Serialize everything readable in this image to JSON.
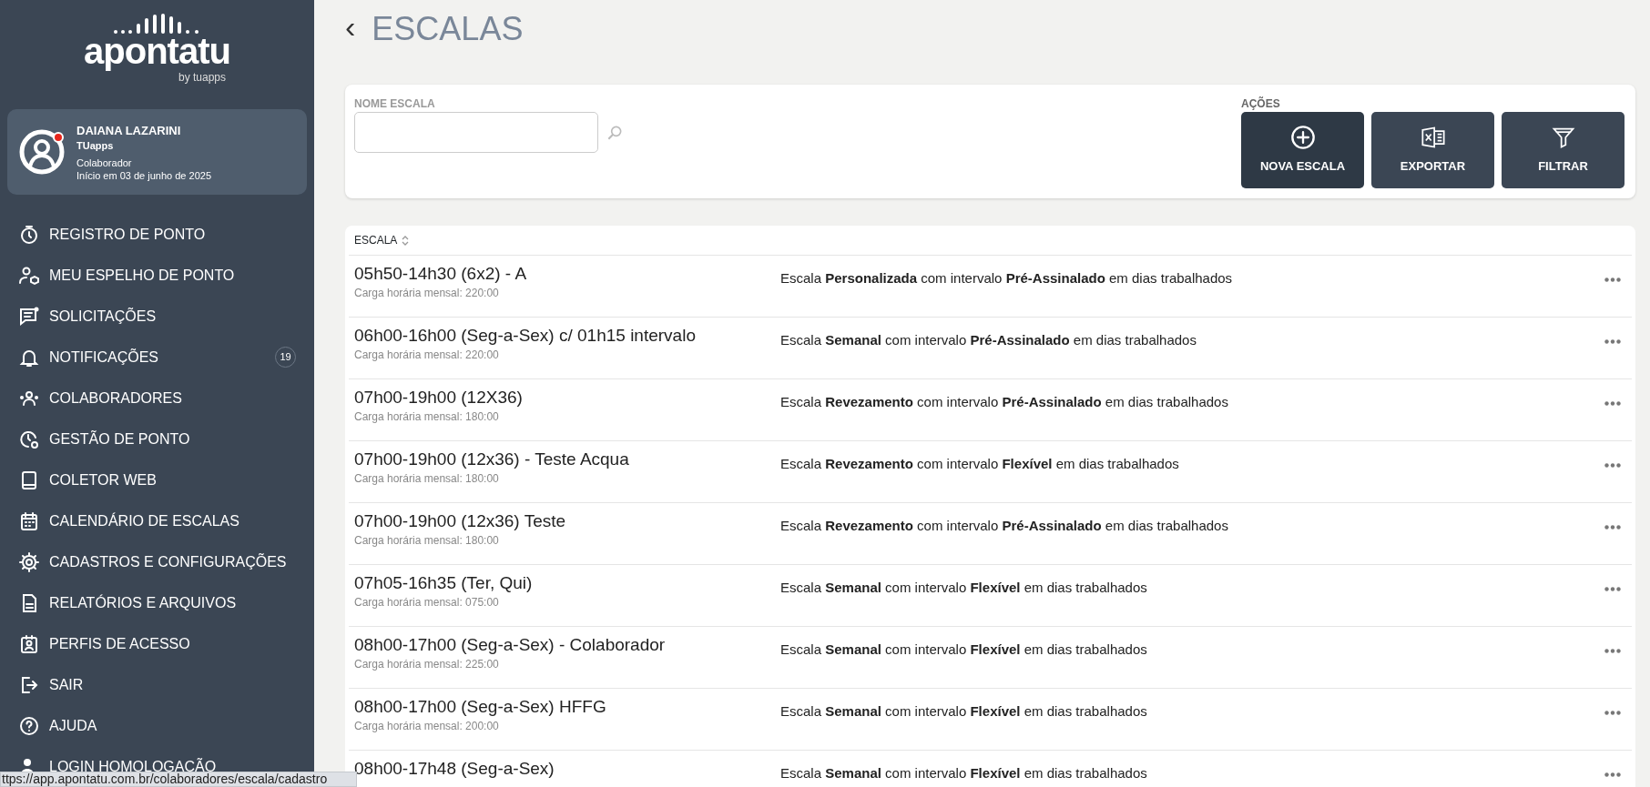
{
  "sidebar": {
    "logo": {
      "name": "apontatu",
      "tagline": "by tuapps"
    },
    "user": {
      "name": "DAIANA LAZARINI",
      "company": "TUapps",
      "role": "Colaborador",
      "since": "Início em 03 de junho de 2025",
      "online": true
    },
    "items": [
      {
        "label": "REGISTRO DE PONTO"
      },
      {
        "label": "MEU ESPELHO DE PONTO"
      },
      {
        "label": "SOLICITAÇÕES"
      },
      {
        "label": "NOTIFICAÇÕES",
        "badge": "19"
      },
      {
        "label": "COLABORADORES"
      },
      {
        "label": "GESTÃO DE PONTO"
      },
      {
        "label": "COLETOR WEB"
      },
      {
        "label": "CALENDÁRIO DE ESCALAS"
      },
      {
        "label": "CADASTROS E CONFIGURAÇÕES"
      },
      {
        "label": "RELATÓRIOS E ARQUIVOS"
      },
      {
        "label": "PERFIS DE ACESSO"
      },
      {
        "label": "SAIR"
      },
      {
        "label": "AJUDA"
      },
      {
        "label": "LOGIN HOMOLOGAÇÃO"
      }
    ]
  },
  "page": {
    "back": "‹",
    "title": "ESCALAS"
  },
  "filter": {
    "label": "NOME ESCALA",
    "actions_label": "AÇÕES",
    "actions": [
      {
        "label": "NOVA ESCALA",
        "kind": "primary"
      },
      {
        "label": "EXPORTAR",
        "kind": "secondary"
      },
      {
        "label": "FILTRAR",
        "kind": "secondary"
      }
    ]
  },
  "table": {
    "columns": [
      "ESCALA"
    ],
    "rows": [
      {
        "name": "05h50-14h30 (6x2) - A",
        "hours": "Carga horária mensal: 220:00",
        "description": "Escala **Personalizada** com intervalo **Pré-Assinalado** em dias trabalhados"
      },
      {
        "name": "06h00-16h00 (Seg-a-Sex) c/ 01h15 intervalo",
        "hours": "Carga horária mensal: 220:00",
        "description": "Escala **Semanal** com intervalo **Pré-Assinalado** em dias trabalhados"
      },
      {
        "name": "07h00-19h00 (12X36)",
        "hours": "Carga horária mensal: 180:00",
        "description": "Escala **Revezamento** com intervalo **Pré-Assinalado** em dias trabalhados"
      },
      {
        "name": "07h00-19h00 (12x36) - Teste Acqua",
        "hours": "Carga horária mensal: 180:00",
        "description": "Escala **Revezamento** com intervalo **Flexível** em dias trabalhados"
      },
      {
        "name": "07h00-19h00 (12x36) Teste",
        "hours": "Carga horária mensal: 180:00",
        "description": "Escala **Revezamento** com intervalo **Pré-Assinalado** em dias trabalhados"
      },
      {
        "name": "07h05-16h35 (Ter, Qui)",
        "hours": "Carga horária mensal: 075:00",
        "description": "Escala **Semanal** com intervalo **Flexível** em dias trabalhados"
      },
      {
        "name": "08h00-17h00 (Seg-a-Sex) - Colaborador",
        "hours": "Carga horária mensal: 225:00",
        "description": "Escala **Semanal** com intervalo **Flexível** em dias trabalhados"
      },
      {
        "name": "08h00-17h00 (Seg-a-Sex) HFFG",
        "hours": "Carga horária mensal: 200:00",
        "description": "Escala **Semanal** com intervalo **Flexível** em dias trabalhados"
      },
      {
        "name": "08h00-17h48 (Seg-a-Sex)",
        "description": "Escala **Semanal** com intervalo **Flexível** em dias trabalhados"
      }
    ]
  },
  "status_bar": {
    "url": "ttps://app.apontatu.com.br/colaboradores/escala/cadastro"
  }
}
